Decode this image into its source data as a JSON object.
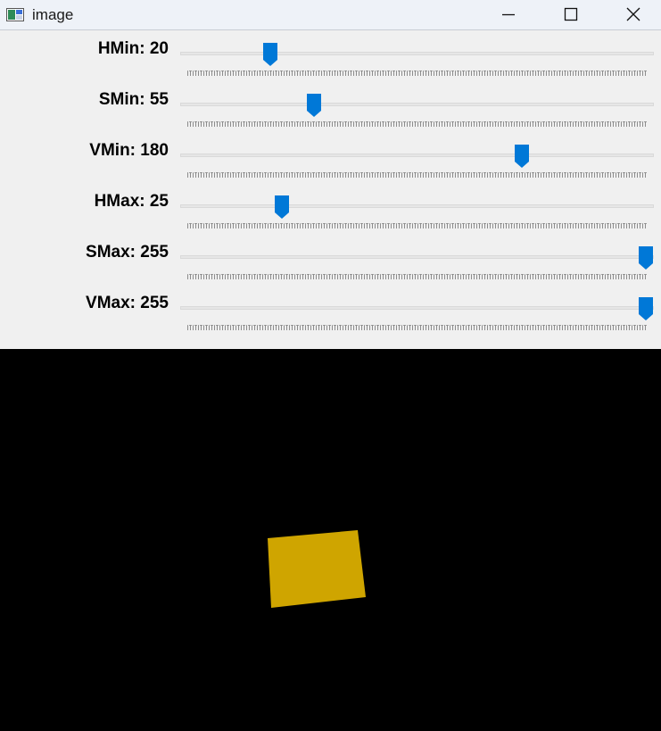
{
  "window": {
    "title": "image",
    "icons": {
      "app": "app-image-icon",
      "minimize": "minimize-icon",
      "maximize": "maximize-icon",
      "close": "close-icon"
    }
  },
  "trackbars": [
    {
      "name": "HMin",
      "label": "HMin: 20",
      "value": 20,
      "max": 179
    },
    {
      "name": "SMin",
      "label": "SMin: 55",
      "value": 55,
      "max": 255
    },
    {
      "name": "VMin",
      "label": "VMin: 180",
      "value": 180,
      "max": 255
    },
    {
      "name": "HMax",
      "label": "HMax: 25",
      "value": 25,
      "max": 179
    },
    {
      "name": "SMax",
      "label": "SMax: 255",
      "value": 255,
      "max": 255
    },
    {
      "name": "VMax",
      "label": "VMax: 255",
      "value": 255,
      "max": 255
    }
  ],
  "colors": {
    "thumb": "#0078d7",
    "detected_object": "#cfa500",
    "background": "#000000",
    "panel": "#f0f0f0"
  }
}
